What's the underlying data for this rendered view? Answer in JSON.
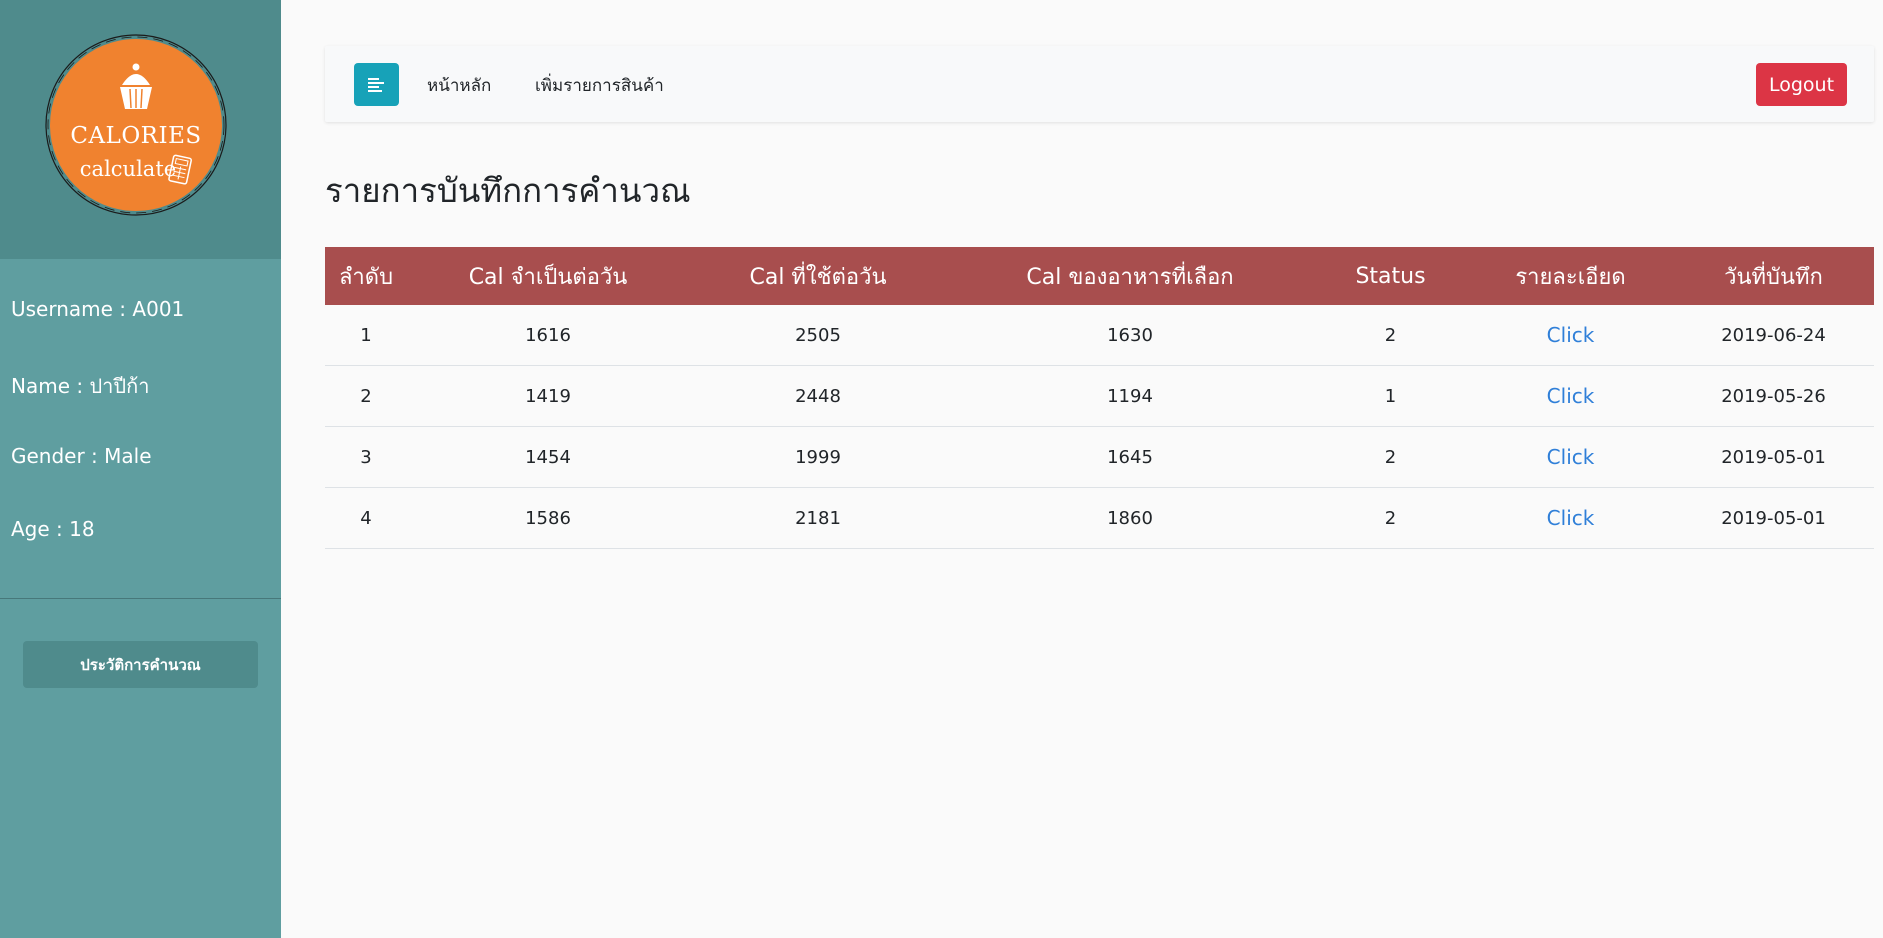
{
  "sidebar": {
    "logo": {
      "line1": "CALORIES",
      "line2": "calculate",
      "colors": {
        "badge": "#f0822f",
        "ring": "#1a1a1a"
      },
      "icons": [
        "cupcake-icon",
        "calculator-icon"
      ]
    },
    "user": {
      "username_label": "Username : ",
      "username_value": "A001",
      "name_label": "Name : ",
      "name_value": "ปาปีก้า",
      "gender_label": "Gender : ",
      "gender_value": "Male",
      "age_label": "Age : ",
      "age_value": "18"
    },
    "history_button": "ประวัติการคำนวณ"
  },
  "navbar": {
    "toggle_icon": "align-left-icon",
    "links": [
      "หน้าหลัก",
      "เพิ่มรายการสินค้า"
    ],
    "logout": "Logout"
  },
  "page": {
    "title": "รายการบันทึกการคำนวณ"
  },
  "table": {
    "headers": [
      "ลำดับ",
      "Cal จำเป็นต่อวัน",
      "Cal ที่ใช้ต่อวัน",
      "Cal ของอาหารที่เลือก",
      "Status",
      "รายละเอียด",
      "วันที่บันทึก"
    ],
    "rows": [
      [
        "1",
        "1616",
        "2505",
        "1630",
        "2",
        "Click",
        "2019-06-24"
      ],
      [
        "2",
        "1419",
        "2448",
        "1194",
        "1",
        "Click",
        "2019-05-26"
      ],
      [
        "3",
        "1454",
        "1999",
        "1645",
        "2",
        "Click",
        "2019-05-01"
      ],
      [
        "4",
        "1586",
        "2181",
        "1860",
        "2",
        "Click",
        "2019-05-01"
      ]
    ]
  },
  "colors": {
    "sidebar_bg": "#5f9ea0",
    "sidebar_header_bg": "#4f8b8c",
    "table_header_bg": "#a84e4e",
    "logout_bg": "#dc3545",
    "toggle_bg": "#17a2b8",
    "link": "#2f7fd8"
  }
}
